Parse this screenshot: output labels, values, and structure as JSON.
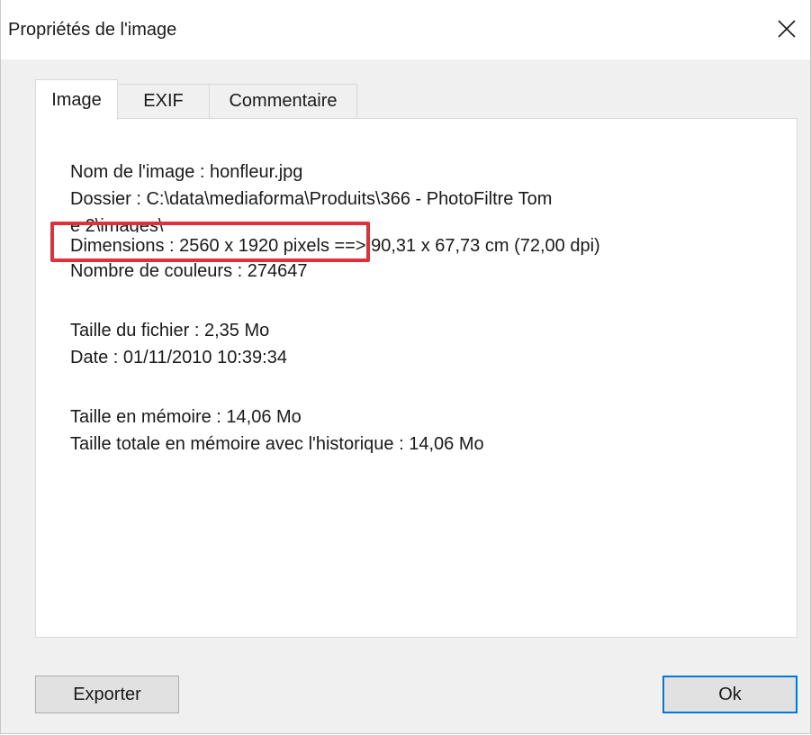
{
  "window": {
    "title": "Propriétés de l'image",
    "close_icon": "close-icon"
  },
  "tabs": [
    {
      "label": "Image",
      "active": true
    },
    {
      "label": "EXIF",
      "active": false
    },
    {
      "label": "Commentaire",
      "active": false
    }
  ],
  "info": {
    "lines": [
      "Nom de l'image : honfleur.jpg",
      "Dossier : C:\\data\\mediaforma\\Produits\\366 - PhotoFiltre Tom",
      "e 2\\images\\",
      "Dimensions : 2560 x 1920 pixels ==> 90,31 x 67,73 cm  (72,00 dpi)",
      "Nombre de couleurs : 274647",
      "Taille du fichier : 2,35 Mo",
      "Date : 01/11/2010 10:39:34",
      "Taille en mémoire : 14,06 Mo",
      "Taille totale en mémoire avec l'historique : 14,06 Mo"
    ],
    "highlight_color": "#e0303a"
  },
  "buttons": {
    "export_label": "Exporter",
    "ok_label": "Ok"
  },
  "colors": {
    "dialog_bg": "#f0f0f0",
    "panel_bg": "#ffffff",
    "accent": "#0078d7"
  }
}
